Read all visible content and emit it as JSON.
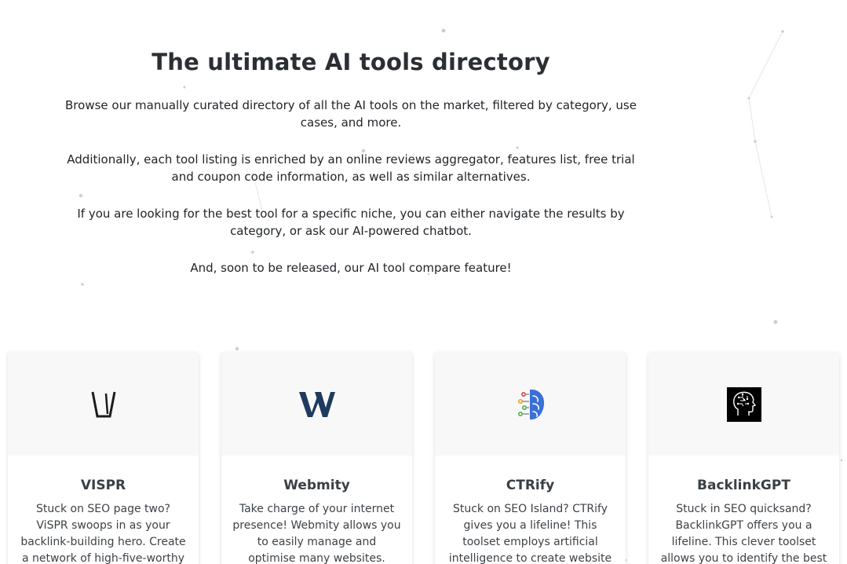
{
  "hero": {
    "title": "The ultimate AI tools directory",
    "paragraphs": [
      "Browse our manually curated directory of all the AI tools on the market, filtered by category, use cases, and more.",
      "Additionally, each tool listing is enriched by an online reviews aggregator, features list, free trial and coupon code information, as well as similar alternatives.",
      "If you are looking for the best tool for a specific niche, you can either navigate the results by category, or ask our AI-powered chatbot.",
      "And, soon to be released, our AI tool compare feature!"
    ]
  },
  "cards": [
    {
      "title": "VISPR",
      "description": "Stuck on SEO page two? ViSPR swoops in as your backlink-building hero. Create a network of high-five-worthy",
      "logo": "vispr-logo"
    },
    {
      "title": "Webmity",
      "description": "Take charge of your internet presence! Webmity allows you to easily manage and optimise many websites.",
      "logo": "webmity-logo"
    },
    {
      "title": "CTRify",
      "description": "Stuck on SEO Island? CTRify gives you a lifeline! This toolset employs artificial intelligence to create website",
      "logo": "ctrify-logo"
    },
    {
      "title": "BacklinkGPT",
      "description": "Stuck in SEO quicksand? BacklinkGPT offers you a lifeline. This clever toolset allows you to identify the best",
      "logo": "backlinkgpt-logo"
    }
  ],
  "colors": {
    "webmity_blue": "#1e3a5f",
    "ctrify_blue": "#3b6fd8",
    "ctrify_accent_green": "#4caf50",
    "ctrify_accent_red": "#e0463a",
    "network_dot": "#c9ced6"
  }
}
